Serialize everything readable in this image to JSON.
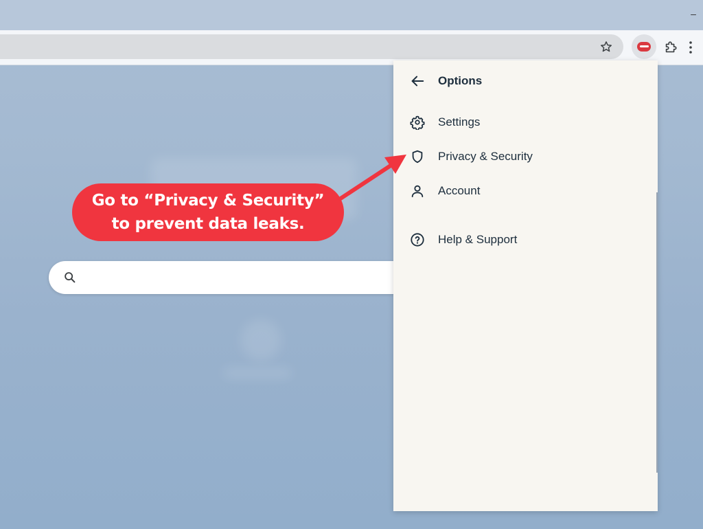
{
  "browser": {
    "minimize_glyph": "–",
    "star_icon": "star-icon",
    "extension_icon": "expressvpn-logo-icon",
    "extensions_icon": "puzzle-icon",
    "menu_icon": "kebab-menu-icon",
    "brand_color": "#da3940"
  },
  "page": {
    "search": {
      "icon": "search-icon",
      "placeholder": ""
    }
  },
  "callout": {
    "line1": "Go to “Privacy & Security”",
    "line2": "to prevent  data leaks.",
    "color": "#f0353f"
  },
  "options_panel": {
    "title": "Options",
    "back_icon": "arrow-left-icon",
    "items": [
      {
        "label": "Settings",
        "icon": "gear-icon"
      },
      {
        "label": "Privacy & Security",
        "icon": "shield-icon"
      },
      {
        "label": "Account",
        "icon": "user-icon"
      },
      {
        "label": "Help & Support",
        "icon": "question-circle-icon"
      }
    ],
    "text_color": "#1d2e3d",
    "background": "#f8f6f1"
  }
}
